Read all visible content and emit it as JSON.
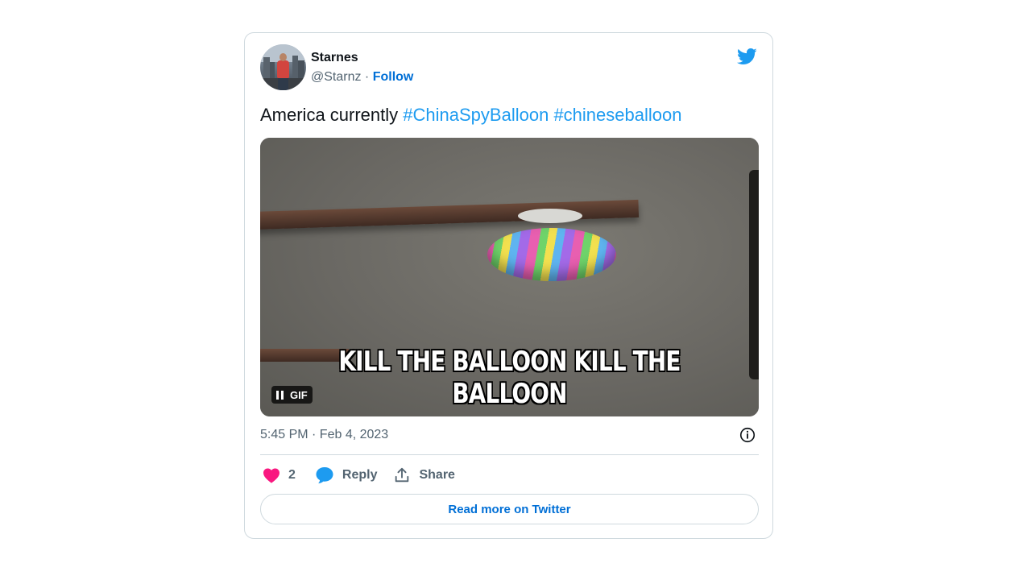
{
  "tweet": {
    "author_name": "Starnes",
    "handle": "@Starnz",
    "separator": " · ",
    "follow_label": "Follow",
    "text_plain": "America currently ",
    "hashtags": [
      "#ChinaSpyBalloon",
      "#chineseballoon"
    ],
    "media": {
      "caption": "KILL THE BALLOON KILL THE BALLOON",
      "badge_label": "GIF"
    },
    "timestamp": "5:45 PM · Feb 4, 2023",
    "actions": {
      "like_count": "2",
      "reply_label": "Reply",
      "share_label": "Share"
    },
    "read_more_label": "Read more on Twitter"
  },
  "icons": {
    "brand": "twitter-bird-icon",
    "like": "heart-icon",
    "reply": "speech-bubble-icon",
    "share": "share-upload-icon",
    "info": "info-icon",
    "pause": "pause-icon"
  },
  "colors": {
    "brand_blue": "#1d9bf0",
    "link_blue": "#006fd6",
    "like_pink": "#f91880",
    "text_primary": "#0f1419",
    "text_secondary": "#536471",
    "border": "#cfd9de"
  }
}
